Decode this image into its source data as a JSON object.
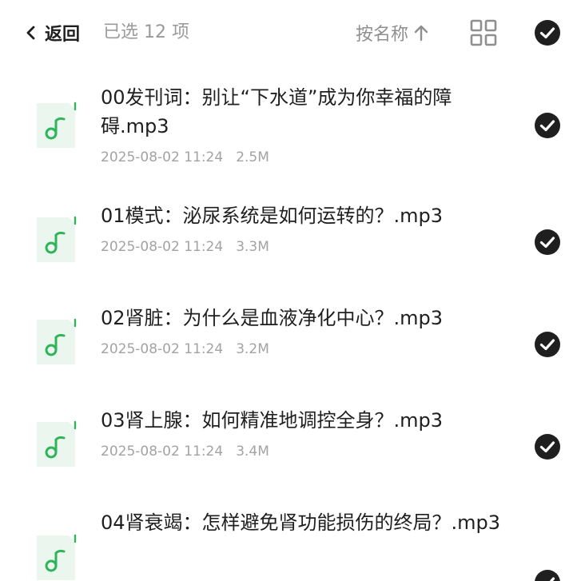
{
  "header": {
    "back_label": "返回",
    "selected_text": "已选 12 项",
    "sort_label": "按名称",
    "header_checkbox_checked": true
  },
  "files": [
    {
      "name": "00发刊词：别让“下水道”成为你幸福的障碍.mp3",
      "date": "2025-08-02 11:24",
      "size": "2.5M",
      "checked": true
    },
    {
      "name": "01模式：泌尿系统是如何运转的？.mp3",
      "date": "2025-08-02 11:24",
      "size": "3.3M",
      "checked": true
    },
    {
      "name": "02肾脏：为什么是血液净化中心？.mp3",
      "date": "2025-08-02 11:24",
      "size": "3.2M",
      "checked": true
    },
    {
      "name": "03肾上腺：如何精准地调控全身？.mp3",
      "date": "2025-08-02 11:24",
      "size": "3.4M",
      "checked": true
    },
    {
      "name": "04肾衰竭：怎样避免肾功能损伤的终局？.mp3",
      "date": "",
      "size": "",
      "checked": true
    }
  ],
  "colors": {
    "checkbox_fill": "#1f1f1f",
    "file_icon_bg": "#eaf6ee",
    "file_icon_accent": "#2fb45a"
  },
  "icons": {
    "back": "chevron-left-icon",
    "sort": "arrow-up-icon",
    "view": "grid-view-icon",
    "file": "music-file-icon",
    "check": "check-circle-icon"
  }
}
